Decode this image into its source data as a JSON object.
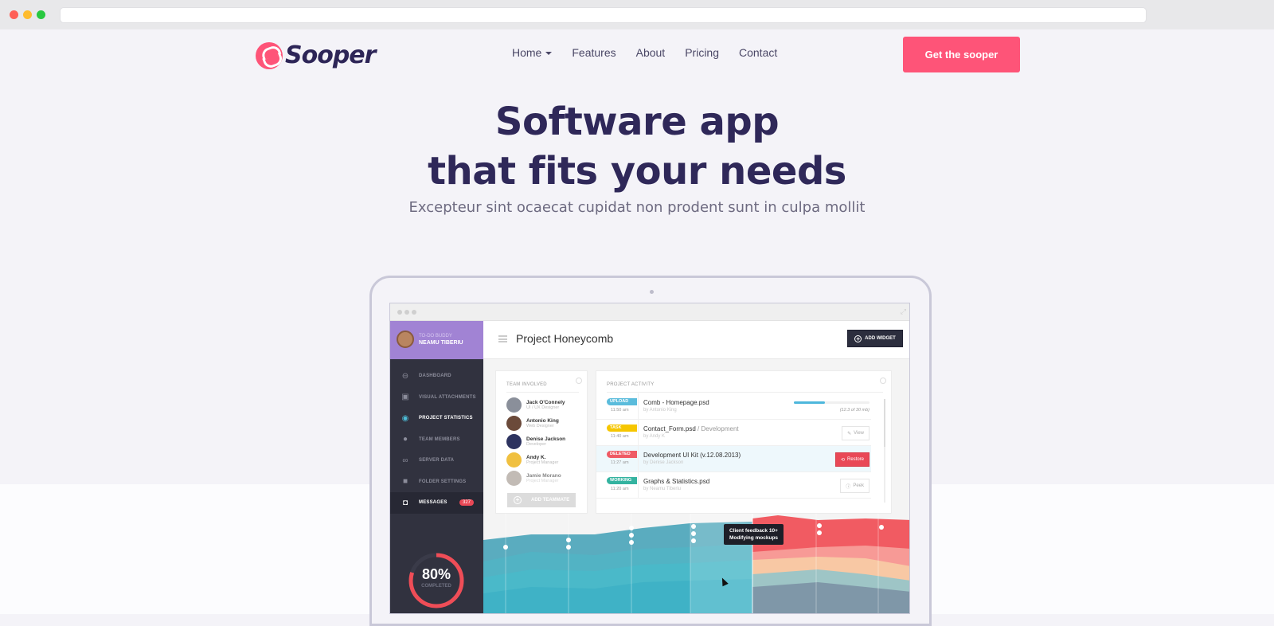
{
  "browser": {
    "url": ""
  },
  "brand": {
    "name": "Sooper",
    "accent": "#fe5478",
    "dark": "#2f2859"
  },
  "nav": {
    "items": [
      {
        "label": "Home",
        "has_dropdown": true
      },
      {
        "label": "Features"
      },
      {
        "label": "About"
      },
      {
        "label": "Pricing"
      },
      {
        "label": "Contact"
      }
    ],
    "cta": "Get the sooper"
  },
  "hero": {
    "title_line1": "Software app",
    "title_line2": "that fits your needs",
    "subtitle": "Excepteur sint ocaecat cupidat non prodent sunt in culpa mollit"
  },
  "app": {
    "user": {
      "small": "TO-DO BUDDY",
      "name": "NEAMU TIBERIU"
    },
    "sidebar": [
      {
        "label": "DASHBOARD",
        "icon": "dashboard-icon"
      },
      {
        "label": "VISUAL ATTACHMENTS",
        "icon": "image-icon"
      },
      {
        "label": "PROJECT STATISTICS",
        "icon": "eye-icon",
        "active": true
      },
      {
        "label": "TEAM MEMBERS",
        "icon": "user-icon"
      },
      {
        "label": "SERVER DATA",
        "icon": "infinity-icon"
      },
      {
        "label": "FOLDER SETTINGS",
        "icon": "folder-icon"
      },
      {
        "label": "MESSAGES",
        "icon": "inbox-icon",
        "badge": "327"
      }
    ],
    "progress": {
      "value": "80%",
      "fraction": 0.8,
      "label": "COMPLETED"
    },
    "project_title": "Project Honeycomb",
    "add_widget": "ADD WIDGET",
    "team": {
      "title": "TEAM INVOLVED",
      "members": [
        {
          "name": "Jack O'Connely",
          "role": "UI / UX Designer"
        },
        {
          "name": "Antonio King",
          "role": "Web Designer"
        },
        {
          "name": "Denise Jackson",
          "role": "Developer"
        },
        {
          "name": "Andy K.",
          "role": "Project Manager"
        },
        {
          "name": "Jamie Morano",
          "role": "Project Manager"
        }
      ],
      "add_button": "ADD TEAMMATE"
    },
    "activity": {
      "title": "PROJECT ACTIVITY",
      "rows": [
        {
          "tag": "UPLOAD",
          "tag_color": "#5bbcdc",
          "time": "11:50 am",
          "title": "Comb - Homepage.psd",
          "suffix": "",
          "by": "by Antonio King",
          "progress": 0.41,
          "progress_note": "(12.3 of 30 mb)"
        },
        {
          "tag": "TASK",
          "tag_color": "#f6c600",
          "time": "11:40 am",
          "title": "Contact_Form.psd",
          "suffix": " / Development",
          "by": "by Andy K",
          "button": "View"
        },
        {
          "tag": "DELETED",
          "tag_color": "#ef5a64",
          "time": "11:27 am",
          "title": "Development UI Kit (v.12.08.2013)",
          "suffix": "",
          "by": "by Denise Jackson",
          "button": "Restore",
          "highlight": true
        },
        {
          "tag": "WORKING",
          "tag_color": "#34b3a0",
          "time": "11:20 am",
          "title": "Graphs & Statistics.psd",
          "suffix": "",
          "by": "by Neamu Tiberiu",
          "button": "Peek"
        }
      ]
    },
    "tooltip": {
      "line1": "Client feedback 10+",
      "line2": "Modifying mockups"
    }
  }
}
